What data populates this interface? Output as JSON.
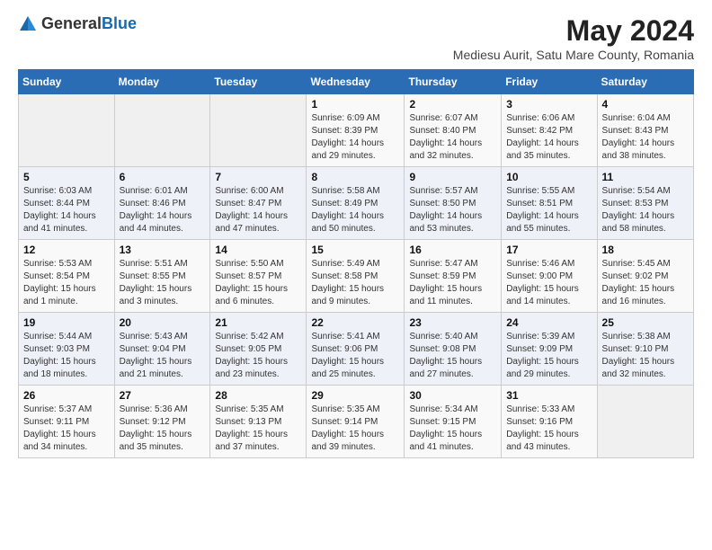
{
  "header": {
    "logo_line1": "General",
    "logo_line2": "Blue",
    "title": "May 2024",
    "subtitle": "Mediesu Aurit, Satu Mare County, Romania"
  },
  "weekdays": [
    "Sunday",
    "Monday",
    "Tuesday",
    "Wednesday",
    "Thursday",
    "Friday",
    "Saturday"
  ],
  "weeks": [
    [
      {
        "day": "",
        "info": ""
      },
      {
        "day": "",
        "info": ""
      },
      {
        "day": "",
        "info": ""
      },
      {
        "day": "1",
        "info": "Sunrise: 6:09 AM\nSunset: 8:39 PM\nDaylight: 14 hours\nand 29 minutes."
      },
      {
        "day": "2",
        "info": "Sunrise: 6:07 AM\nSunset: 8:40 PM\nDaylight: 14 hours\nand 32 minutes."
      },
      {
        "day": "3",
        "info": "Sunrise: 6:06 AM\nSunset: 8:42 PM\nDaylight: 14 hours\nand 35 minutes."
      },
      {
        "day": "4",
        "info": "Sunrise: 6:04 AM\nSunset: 8:43 PM\nDaylight: 14 hours\nand 38 minutes."
      }
    ],
    [
      {
        "day": "5",
        "info": "Sunrise: 6:03 AM\nSunset: 8:44 PM\nDaylight: 14 hours\nand 41 minutes."
      },
      {
        "day": "6",
        "info": "Sunrise: 6:01 AM\nSunset: 8:46 PM\nDaylight: 14 hours\nand 44 minutes."
      },
      {
        "day": "7",
        "info": "Sunrise: 6:00 AM\nSunset: 8:47 PM\nDaylight: 14 hours\nand 47 minutes."
      },
      {
        "day": "8",
        "info": "Sunrise: 5:58 AM\nSunset: 8:49 PM\nDaylight: 14 hours\nand 50 minutes."
      },
      {
        "day": "9",
        "info": "Sunrise: 5:57 AM\nSunset: 8:50 PM\nDaylight: 14 hours\nand 53 minutes."
      },
      {
        "day": "10",
        "info": "Sunrise: 5:55 AM\nSunset: 8:51 PM\nDaylight: 14 hours\nand 55 minutes."
      },
      {
        "day": "11",
        "info": "Sunrise: 5:54 AM\nSunset: 8:53 PM\nDaylight: 14 hours\nand 58 minutes."
      }
    ],
    [
      {
        "day": "12",
        "info": "Sunrise: 5:53 AM\nSunset: 8:54 PM\nDaylight: 15 hours\nand 1 minute."
      },
      {
        "day": "13",
        "info": "Sunrise: 5:51 AM\nSunset: 8:55 PM\nDaylight: 15 hours\nand 3 minutes."
      },
      {
        "day": "14",
        "info": "Sunrise: 5:50 AM\nSunset: 8:57 PM\nDaylight: 15 hours\nand 6 minutes."
      },
      {
        "day": "15",
        "info": "Sunrise: 5:49 AM\nSunset: 8:58 PM\nDaylight: 15 hours\nand 9 minutes."
      },
      {
        "day": "16",
        "info": "Sunrise: 5:47 AM\nSunset: 8:59 PM\nDaylight: 15 hours\nand 11 minutes."
      },
      {
        "day": "17",
        "info": "Sunrise: 5:46 AM\nSunset: 9:00 PM\nDaylight: 15 hours\nand 14 minutes."
      },
      {
        "day": "18",
        "info": "Sunrise: 5:45 AM\nSunset: 9:02 PM\nDaylight: 15 hours\nand 16 minutes."
      }
    ],
    [
      {
        "day": "19",
        "info": "Sunrise: 5:44 AM\nSunset: 9:03 PM\nDaylight: 15 hours\nand 18 minutes."
      },
      {
        "day": "20",
        "info": "Sunrise: 5:43 AM\nSunset: 9:04 PM\nDaylight: 15 hours\nand 21 minutes."
      },
      {
        "day": "21",
        "info": "Sunrise: 5:42 AM\nSunset: 9:05 PM\nDaylight: 15 hours\nand 23 minutes."
      },
      {
        "day": "22",
        "info": "Sunrise: 5:41 AM\nSunset: 9:06 PM\nDaylight: 15 hours\nand 25 minutes."
      },
      {
        "day": "23",
        "info": "Sunrise: 5:40 AM\nSunset: 9:08 PM\nDaylight: 15 hours\nand 27 minutes."
      },
      {
        "day": "24",
        "info": "Sunrise: 5:39 AM\nSunset: 9:09 PM\nDaylight: 15 hours\nand 29 minutes."
      },
      {
        "day": "25",
        "info": "Sunrise: 5:38 AM\nSunset: 9:10 PM\nDaylight: 15 hours\nand 32 minutes."
      }
    ],
    [
      {
        "day": "26",
        "info": "Sunrise: 5:37 AM\nSunset: 9:11 PM\nDaylight: 15 hours\nand 34 minutes."
      },
      {
        "day": "27",
        "info": "Sunrise: 5:36 AM\nSunset: 9:12 PM\nDaylight: 15 hours\nand 35 minutes."
      },
      {
        "day": "28",
        "info": "Sunrise: 5:35 AM\nSunset: 9:13 PM\nDaylight: 15 hours\nand 37 minutes."
      },
      {
        "day": "29",
        "info": "Sunrise: 5:35 AM\nSunset: 9:14 PM\nDaylight: 15 hours\nand 39 minutes."
      },
      {
        "day": "30",
        "info": "Sunrise: 5:34 AM\nSunset: 9:15 PM\nDaylight: 15 hours\nand 41 minutes."
      },
      {
        "day": "31",
        "info": "Sunrise: 5:33 AM\nSunset: 9:16 PM\nDaylight: 15 hours\nand 43 minutes."
      },
      {
        "day": "",
        "info": ""
      }
    ]
  ]
}
